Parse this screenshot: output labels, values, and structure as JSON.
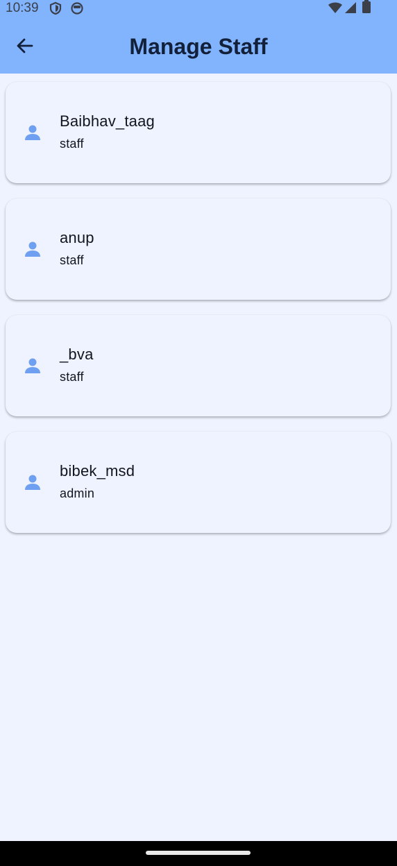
{
  "status_bar": {
    "time": "10:39",
    "icons": [
      "shield-icon",
      "face-icon",
      "wifi-icon",
      "signal-icon",
      "battery-icon"
    ]
  },
  "app_bar": {
    "title": "Manage Staff",
    "back_icon": "arrow-back-icon",
    "background": "#82b4fe"
  },
  "staff": [
    {
      "name": "Baibhav_taag",
      "role": "staff",
      "icon": "person-icon"
    },
    {
      "name": "anup",
      "role": "staff",
      "icon": "person-icon"
    },
    {
      "name": "_bva",
      "role": "staff",
      "icon": "person-icon"
    },
    {
      "name": "bibek_msd",
      "role": "admin",
      "icon": "person-icon"
    }
  ],
  "colors": {
    "page_background": "#eef3ff",
    "accent": "#6f9ff0"
  }
}
